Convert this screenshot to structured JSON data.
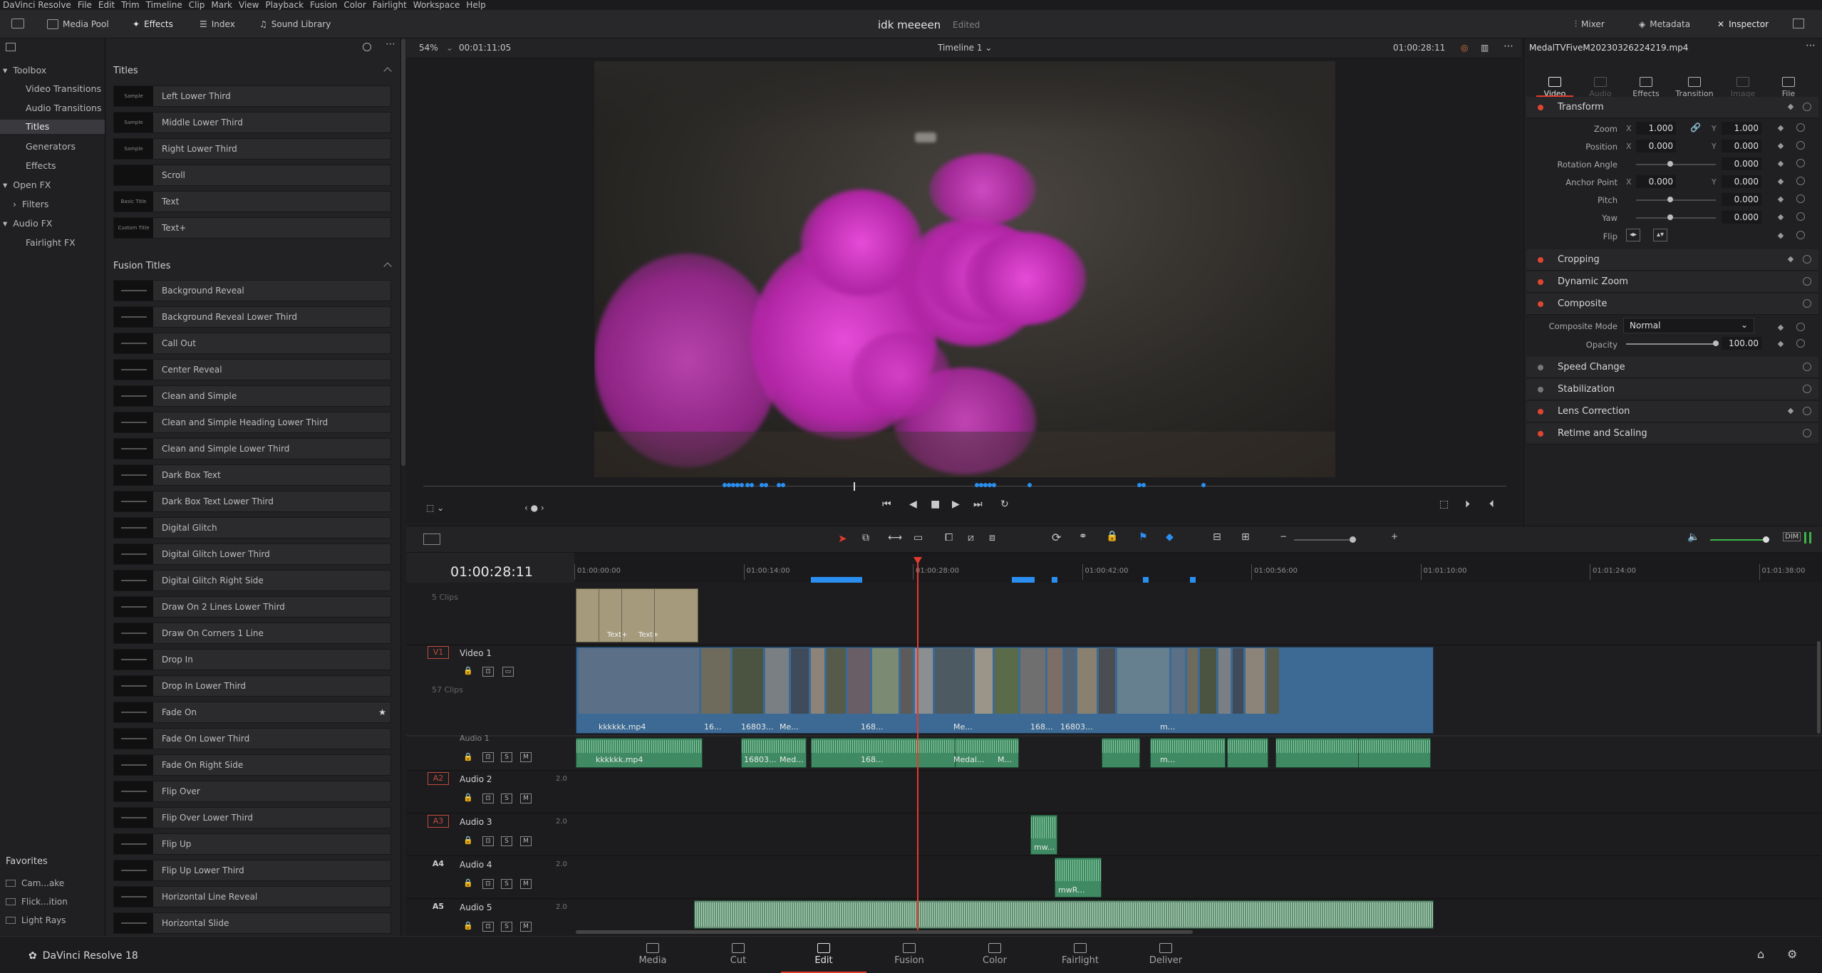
{
  "menu": [
    "DaVinci Resolve",
    "File",
    "Edit",
    "Trim",
    "Timeline",
    "Clip",
    "Mark",
    "View",
    "Playback",
    "Fusion",
    "Color",
    "Fairlight",
    "Workspace",
    "Help"
  ],
  "toolbar": {
    "media_pool": "Media Pool",
    "effects": "Effects",
    "index": "Index",
    "sound_library": "Sound Library",
    "project_title": "idk meeeen",
    "project_status": "Edited",
    "mixer": "Mixer",
    "metadata": "Metadata",
    "inspector": "Inspector"
  },
  "toolbox": {
    "items": [
      {
        "label": "Toolbox"
      },
      {
        "label": "Video Transitions"
      },
      {
        "label": "Audio Transitions"
      },
      {
        "label": "Titles"
      },
      {
        "label": "Generators"
      },
      {
        "label": "Effects"
      },
      {
        "label": "Open FX"
      },
      {
        "label": "Filters"
      },
      {
        "label": "Audio FX"
      },
      {
        "label": "Fairlight FX"
      }
    ]
  },
  "favorites": {
    "header": "Favorites",
    "items": [
      "Cam...ake",
      "Flick...ition",
      "Light Rays"
    ]
  },
  "titles_section": {
    "header": "Titles",
    "items": [
      {
        "label": "Left Lower Third",
        "thumb": "Sample"
      },
      {
        "label": "Middle Lower Third",
        "thumb": "Sample"
      },
      {
        "label": "Right Lower Third",
        "thumb": "Sample"
      },
      {
        "label": "Scroll",
        "thumb": ""
      },
      {
        "label": "Text",
        "thumb": "Basic Title"
      },
      {
        "label": "Text+",
        "thumb": "Custom Title"
      }
    ]
  },
  "fusion_section": {
    "header": "Fusion Titles",
    "items": [
      "Background Reveal",
      "Background Reveal Lower Third",
      "Call Out",
      "Center Reveal",
      "Clean and Simple",
      "Clean and Simple Heading Lower Third",
      "Clean and Simple Lower Third",
      "Dark Box Text",
      "Dark Box Text Lower Third",
      "Digital Glitch",
      "Digital Glitch Lower Third",
      "Digital Glitch Right Side",
      "Draw On 2 Lines Lower Third",
      "Draw On Corners 1 Line",
      "Drop In",
      "Drop In Lower Third",
      "Fade On",
      "Fade On Lower Third",
      "Fade On Right Side",
      "Flip Over",
      "Flip Over Lower Third",
      "Flip Up",
      "Flip Up Lower Third",
      "Horizontal Line Reveal",
      "Horizontal Slide"
    ]
  },
  "viewer": {
    "zoom": "54%",
    "duration": "00:01:11:05",
    "timeline_name": "Timeline 1",
    "timecode": "01:00:28:11"
  },
  "inspector": {
    "file_name": "MedalTVFiveM20230326224219.mp4",
    "tabs": [
      {
        "label": "Video",
        "active": true
      },
      {
        "label": "Audio",
        "active": false
      },
      {
        "label": "Effects",
        "active": true
      },
      {
        "label": "Transition",
        "active": true
      },
      {
        "label": "Image",
        "active": false
      },
      {
        "label": "File",
        "active": true
      }
    ],
    "transform": {
      "title": "Transform",
      "zoom_label": "Zoom",
      "zoom_x": "1.000",
      "zoom_y": "1.000",
      "position_label": "Position",
      "position_x": "0.000",
      "position_y": "0.000",
      "rotation_label": "Rotation Angle",
      "rotation": "0.000",
      "anchor_label": "Anchor Point",
      "anchor_x": "0.000",
      "anchor_y": "0.000",
      "pitch_label": "Pitch",
      "pitch": "0.000",
      "yaw_label": "Yaw",
      "yaw": "0.000",
      "flip_label": "Flip"
    },
    "cropping": "Cropping",
    "dynamic_zoom": "Dynamic Zoom",
    "composite": {
      "title": "Composite",
      "mode_label": "Composite Mode",
      "mode": "Normal",
      "opacity_label": "Opacity",
      "opacity": "100.00"
    },
    "speed_change": "Speed Change",
    "stabilization": "Stabilization",
    "lens_correction": "Lens Correction",
    "retime": "Retime and Scaling"
  },
  "timeline": {
    "timecode": "01:00:28:11",
    "ruler": [
      "01:00:00:00",
      "01:00:14:00",
      "01:00:28:00",
      "01:00:42:00",
      "01:00:56:00",
      "01:01:10:00",
      "01:01:24:00",
      "01:01:38:00"
    ],
    "v2_clips": "5 Clips",
    "v1_clips": "57 Clips",
    "tracks": {
      "v1": {
        "tag": "V1",
        "name": "Video 1"
      },
      "a1": {
        "name": "Audio 1"
      },
      "a2": {
        "tag": "A2",
        "name": "Audio 2",
        "ch": "2.0"
      },
      "a3": {
        "tag": "A3",
        "name": "Audio 3",
        "ch": "2.0"
      },
      "a4": {
        "tag": "A4",
        "name": "Audio 4",
        "ch": "2.0"
      },
      "a5": {
        "tag": "A5",
        "name": "Audio 5",
        "ch": "2.0"
      }
    },
    "text_clip_labels": [
      "Text+",
      "Text+"
    ],
    "video_clip_labels": [
      "kkkkkk.mp4",
      "16...",
      "16803...",
      "Me...",
      "168...",
      "Me...",
      "168...",
      "16803...",
      "m..."
    ],
    "audio_clip_labels": [
      "kkkkkk.mp4",
      "16803...",
      "Med...",
      "168...",
      "Medal...",
      "M...",
      "m..."
    ],
    "a3_clip": "mw...",
    "a4_clip": "mwR..."
  },
  "pages": [
    {
      "label": "Media",
      "active": false
    },
    {
      "label": "Cut",
      "active": false
    },
    {
      "label": "Edit",
      "active": true
    },
    {
      "label": "Fusion",
      "active": false
    },
    {
      "label": "Color",
      "active": false
    },
    {
      "label": "Fairlight",
      "active": false
    },
    {
      "label": "Deliver",
      "active": false
    }
  ],
  "brand": "DaVinci Resolve 18",
  "colors": {
    "accent": "#e23b2e",
    "video_clip": "#3c6a94",
    "audio_clip": "#3f8a63",
    "marker": "#2a8ff0"
  }
}
